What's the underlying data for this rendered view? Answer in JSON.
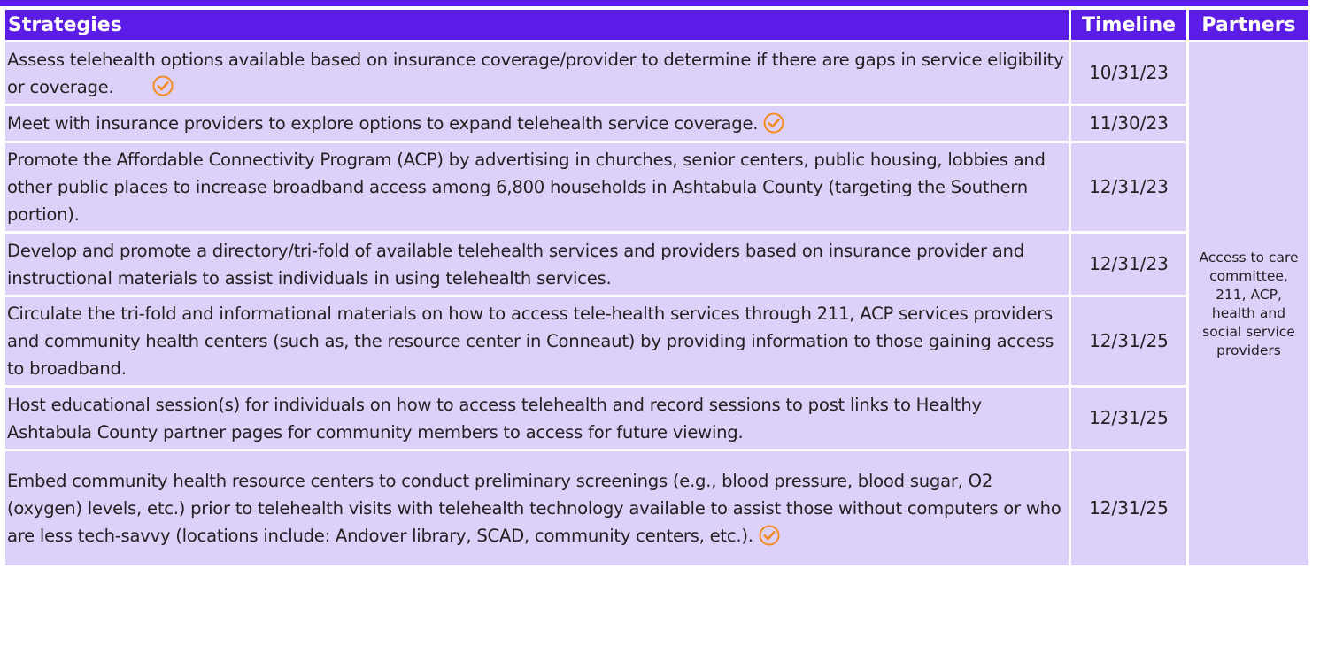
{
  "table": {
    "headers": {
      "strategies": "Strategies",
      "timeline": "Timeline",
      "partners": "Partners"
    },
    "partners_text": "Access to care committee, 211, ACP, health and social service providers",
    "rows": [
      {
        "strategy": "Assess telehealth options available based on insurance coverage/provider to determine if there are gaps in service eligibility or coverage.",
        "timeline": "10/31/23",
        "completed": true
      },
      {
        "strategy": "Meet with insurance providers to explore options to expand telehealth service coverage.",
        "timeline": "11/30/23",
        "completed": true
      },
      {
        "strategy": "Promote the Affordable Connectivity Program (ACP) by advertising in churches, senior centers, public housing, lobbies and other public places to increase broadband access among 6,800 households in Ashtabula County (targeting the Southern portion).",
        "timeline": "12/31/23",
        "completed": false
      },
      {
        "strategy": "Develop and promote a directory/tri-fold of available telehealth services and providers based on insurance provider and instructional materials to assist individuals in using telehealth services.",
        "timeline": "12/31/23",
        "completed": false
      },
      {
        "strategy": "Circulate the tri-fold and informational materials on how to access tele-health services through 211, ACP services providers and community health centers (such as, the resource center in Conneaut) by providing information to those gaining access to broadband.",
        "timeline": "12/31/25",
        "completed": false
      },
      {
        "strategy": "Host educational session(s) for individuals on how to access telehealth and record sessions to post links to Healthy Ashtabula County partner pages for community members to access for future viewing.",
        "timeline": "12/31/25",
        "completed": false
      },
      {
        "strategy": "Embed community health resource centers to conduct preliminary screenings (e.g., blood pressure, blood sugar, O2 (oxygen) levels, etc.) prior to telehealth visits with telehealth technology available to assist those without computers or who are less tech-savvy (locations include: Andover library, SCAD, community centers, etc.).",
        "timeline": "12/31/25",
        "completed": true
      }
    ]
  },
  "colors": {
    "header_bg": "#5b1ce8",
    "cell_bg": "#ddd0fb",
    "check_color": "#f58a1f"
  },
  "icons": {
    "completed": "check-circle-icon"
  }
}
